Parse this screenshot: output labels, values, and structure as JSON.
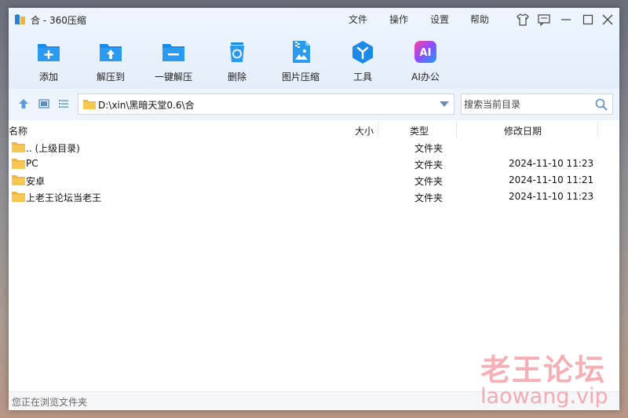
{
  "window": {
    "title": "合 - 360压缩",
    "menu": [
      "文件",
      "操作",
      "设置",
      "帮助"
    ]
  },
  "toolbar": {
    "items": [
      {
        "label": "添加",
        "icon": "add-icon"
      },
      {
        "label": "解压到",
        "icon": "extract-to-icon"
      },
      {
        "label": "一键解压",
        "icon": "one-click-extract-icon"
      },
      {
        "label": "删除",
        "icon": "recycle-bin-icon"
      },
      {
        "label": "图片压缩",
        "icon": "image-compress-icon"
      },
      {
        "label": "工具",
        "icon": "tools-icon"
      },
      {
        "label": "AI办公",
        "icon": "ai-office-icon"
      }
    ],
    "ai_badge": "AI"
  },
  "address": {
    "path": "D:\\xin\\黑暗天堂0.6\\合",
    "search_placeholder": "搜索当前目录"
  },
  "columns": {
    "name": "名称",
    "size": "大小",
    "type": "类型",
    "date": "修改日期"
  },
  "files": [
    {
      "name": ".. (上级目录)",
      "type": "文件夹",
      "date": ""
    },
    {
      "name": "PC",
      "type": "文件夹",
      "date": "2024-11-10 11:23"
    },
    {
      "name": "安卓",
      "type": "文件夹",
      "date": "2024-11-10 11:21"
    },
    {
      "name": "上老王论坛当老王",
      "type": "文件夹",
      "date": "2024-11-10 11:23"
    }
  ],
  "status": {
    "text": "您正在浏览文件夹"
  },
  "watermark": {
    "line1": "老王论坛",
    "line2": "laowang.vip"
  },
  "colors": {
    "accent": "#1a8be8",
    "folder": "#f5c04a",
    "watermark": "#ee6e78"
  }
}
